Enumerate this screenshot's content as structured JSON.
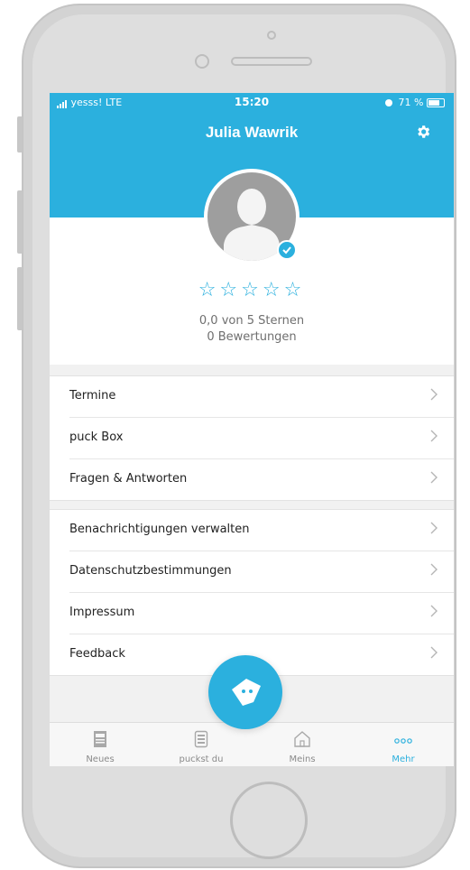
{
  "status": {
    "carrier": "yesss!",
    "network": "LTE",
    "time": "15:20",
    "battery": "71 %"
  },
  "header": {
    "title": "Julia Wawrik"
  },
  "profile": {
    "stars": "☆☆☆☆☆",
    "rating_text": "0,0 von 5 Sternen",
    "reviews_text": "0 Bewertungen",
    "stars_value": 0
  },
  "menu1": [
    {
      "label": "Termine"
    },
    {
      "label": "puck Box"
    },
    {
      "label": "Fragen & Antworten"
    }
  ],
  "menu2": [
    {
      "label": "Benachrichtigungen verwalten"
    },
    {
      "label": "Datenschutzbestimmungen"
    },
    {
      "label": "Impressum"
    },
    {
      "label": "Feedback"
    }
  ],
  "tabs": [
    {
      "label": "Neues"
    },
    {
      "label": "puckst du"
    },
    {
      "label": "Meins"
    },
    {
      "label": "Mehr"
    }
  ],
  "colors": {
    "accent": "#2bb0de"
  }
}
